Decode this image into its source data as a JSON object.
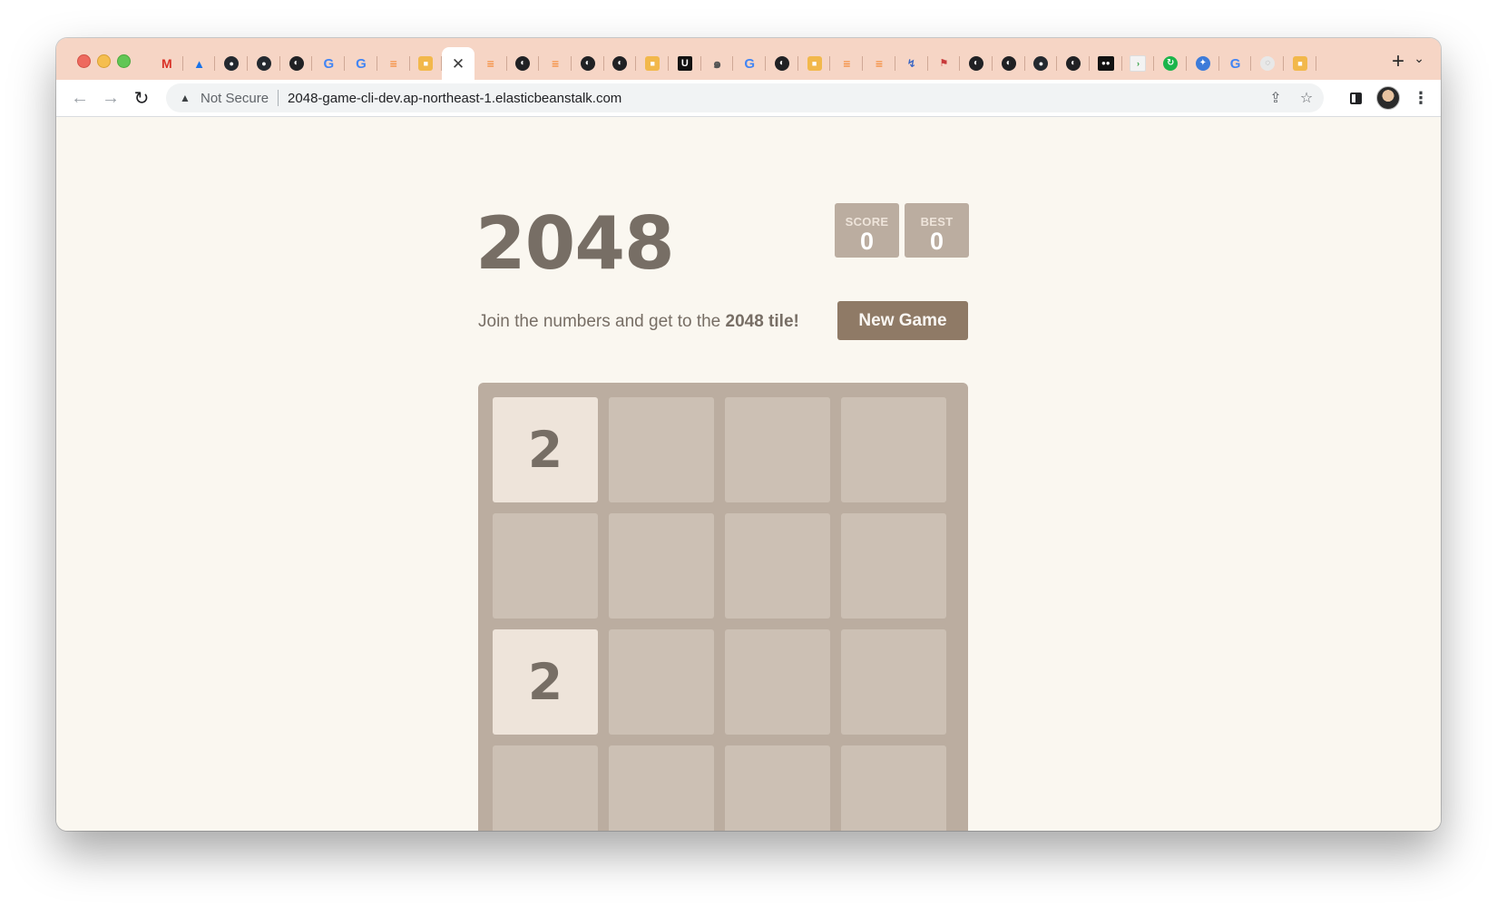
{
  "browser": {
    "tabs": [
      {
        "icon": "gmail-icon",
        "glyph": "M",
        "style": "fav-gmail"
      },
      {
        "icon": "google-drive-icon",
        "glyph": "▲",
        "style": "fav-drive"
      },
      {
        "icon": "github-icon",
        "glyph": "●",
        "style": "fav-github"
      },
      {
        "icon": "github-icon",
        "glyph": "●",
        "style": "fav-github"
      },
      {
        "icon": "globe-icon",
        "glyph": "◐",
        "style": "fav-globe"
      },
      {
        "icon": "google-icon",
        "glyph": "G",
        "style": "fav-google"
      },
      {
        "icon": "google-icon",
        "glyph": "G",
        "style": "fav-google"
      },
      {
        "icon": "stackoverflow-icon",
        "glyph": "≡",
        "style": "fav-stack"
      },
      {
        "icon": "box-icon",
        "glyph": "■",
        "style": "fav-box"
      },
      {
        "icon": "close-icon",
        "glyph": "✕",
        "style": "fav-close",
        "active": true
      },
      {
        "icon": "stackoverflow-icon",
        "glyph": "≡",
        "style": "fav-stack"
      },
      {
        "icon": "globe-icon",
        "glyph": "◐",
        "style": "fav-globe"
      },
      {
        "icon": "stackoverflow-icon",
        "glyph": "≡",
        "style": "fav-stack"
      },
      {
        "icon": "globe-icon",
        "glyph": "◐",
        "style": "fav-globe"
      },
      {
        "icon": "globe-icon",
        "glyph": "◐",
        "style": "fav-globe"
      },
      {
        "icon": "box-icon",
        "glyph": "■",
        "style": "fav-box"
      },
      {
        "icon": "udemy-icon",
        "glyph": "U",
        "style": "fav-udemy"
      },
      {
        "icon": "spiral-icon",
        "glyph": "๑",
        "style": "fav-spiral"
      },
      {
        "icon": "google-icon",
        "glyph": "G",
        "style": "fav-google"
      },
      {
        "icon": "globe-icon",
        "glyph": "◐",
        "style": "fav-globe"
      },
      {
        "icon": "box-icon",
        "glyph": "■",
        "style": "fav-box"
      },
      {
        "icon": "stackoverflow-icon",
        "glyph": "≡",
        "style": "fav-stack"
      },
      {
        "icon": "stackoverflow-icon",
        "glyph": "≡",
        "style": "fav-stack"
      },
      {
        "icon": "hand-icon",
        "glyph": "↯",
        "style": "fav-hand"
      },
      {
        "icon": "flag-icon",
        "glyph": "⚑",
        "style": "fav-flag"
      },
      {
        "icon": "globe-icon",
        "glyph": "◐",
        "style": "fav-globe"
      },
      {
        "icon": "globe-icon",
        "glyph": "◐",
        "style": "fav-globe"
      },
      {
        "icon": "github-icon",
        "glyph": "●",
        "style": "fav-github"
      },
      {
        "icon": "globe-icon",
        "glyph": "◐",
        "style": "fav-globe"
      },
      {
        "icon": "medium-icon",
        "glyph": "●●",
        "style": "fav-dots"
      },
      {
        "icon": "terminal-icon",
        "glyph": "›",
        "style": "fav-terminal"
      },
      {
        "icon": "refresh-green-icon",
        "glyph": "↻",
        "style": "fav-green"
      },
      {
        "icon": "blue-circle-icon",
        "glyph": "✦",
        "style": "fav-blue"
      },
      {
        "icon": "google-icon",
        "glyph": "G",
        "style": "fav-google"
      },
      {
        "icon": "light-circle-icon",
        "glyph": "◌",
        "style": "fav-light"
      },
      {
        "icon": "box-icon",
        "glyph": "■",
        "style": "fav-box"
      }
    ],
    "new_tab_glyph": "+",
    "tab_menu_glyph": "⌄",
    "back_glyph": "←",
    "forward_glyph": "→",
    "reload_glyph": "↻",
    "security_icon_glyph": "▲",
    "security_label": "Not Secure",
    "url": "2048-game-cli-dev.ap-northeast-1.elasticbeanstalk.com",
    "share_glyph": "⇪",
    "bookmark_glyph": "☆",
    "menu_glyph": "⋮"
  },
  "game": {
    "title": "2048",
    "score_label": "SCORE",
    "score_value": "0",
    "best_label": "BEST",
    "best_value": "0",
    "intro_prefix": "Join the numbers and get to the ",
    "intro_bold": "2048 tile!",
    "new_game_label": "New Game",
    "grid": [
      [
        "2",
        "",
        "",
        ""
      ],
      [
        "",
        "",
        "",
        ""
      ],
      [
        "2",
        "",
        "",
        ""
      ],
      [
        "",
        "",
        "",
        ""
      ]
    ]
  },
  "colors": {
    "tab_strip": "#f6d5c5",
    "board": "#bbada0",
    "tile_2": "#eee4da",
    "button": "#8f7a66",
    "text": "#776e65",
    "page_bg": "#faf7f0"
  }
}
